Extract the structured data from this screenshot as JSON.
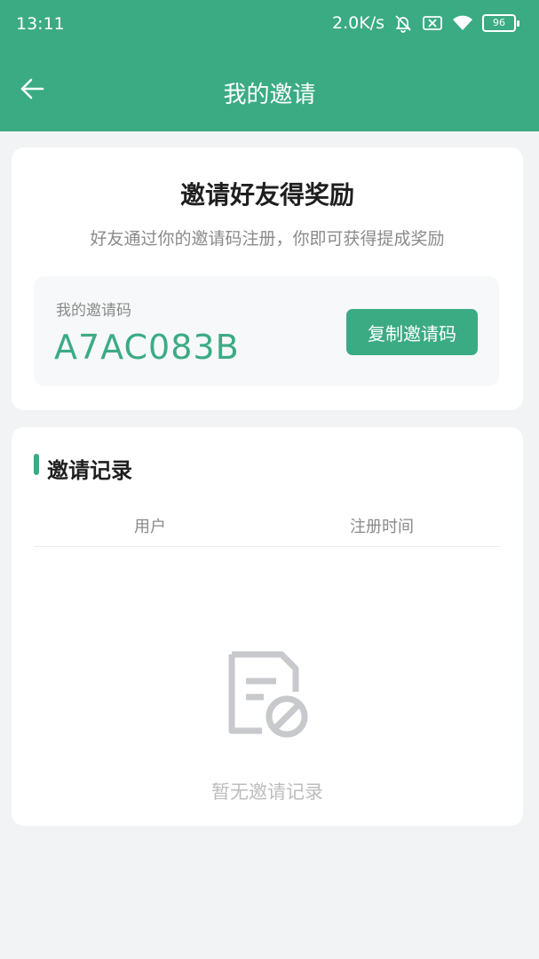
{
  "status_bar": {
    "time": "13:11",
    "speed": "2.0K/s",
    "battery": "96",
    "icons": [
      "bell-off-icon",
      "sim-x-icon",
      "wifi-icon",
      "battery-icon"
    ]
  },
  "nav": {
    "title": "我的邀请",
    "back_icon": "arrow-left-icon"
  },
  "invite": {
    "title": "邀请好友得奖励",
    "subtitle": "好友通过你的邀请码注册，你即可获得提成奖励",
    "code_label": "我的邀请码",
    "code": "A7AC083B",
    "copy_label": "复制邀请码"
  },
  "records": {
    "title": "邀请记录",
    "columns": [
      "用户",
      "注册时间"
    ],
    "rows": [],
    "empty_icon": "empty-document-icon",
    "empty_text": "暂无邀请记录"
  },
  "colors": {
    "accent": "#3bab84",
    "background": "#f2f3f5",
    "muted_text": "#8a8a8a"
  }
}
